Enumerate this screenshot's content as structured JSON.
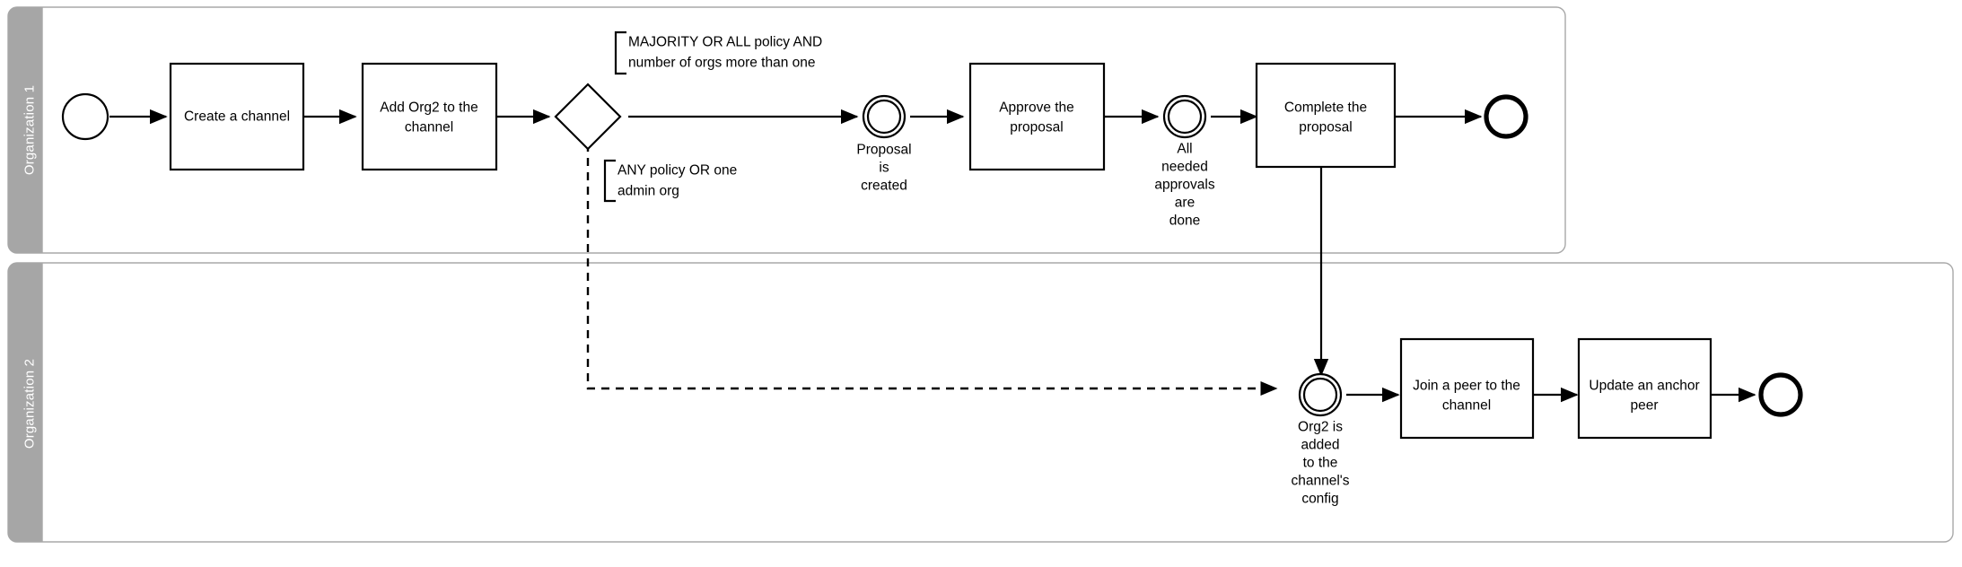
{
  "diagram": {
    "type": "bpmn-collaboration-diagram",
    "background": "#ffffff",
    "lane_band_color": "#a6a6a6",
    "pool_border_color": "#a8a8a8",
    "shape_stroke_color": "#000000"
  },
  "lanes": [
    {
      "id": "lane-organization-1",
      "label": "Organization 1"
    },
    {
      "id": "lane-organization-2",
      "label": "Organization 2"
    }
  ],
  "organization1": {
    "start_event": {
      "label": ""
    },
    "tasks": [
      {
        "id": "task-create-channel",
        "label": "Create a channel"
      },
      {
        "id": "task-add-org2",
        "label": "Add Org2 to the channel"
      },
      {
        "id": "task-approve-proposal",
        "label": "Approve the proposal"
      },
      {
        "id": "task-complete-proposal",
        "label": "Complete the proposal"
      }
    ],
    "task_lines": {
      "create_channel": [
        "Create a channel"
      ],
      "add_org2": [
        "Add Org2 to the",
        "channel"
      ],
      "approve_proposal": [
        "Approve the",
        "proposal"
      ],
      "complete_proposal": [
        "Complete the",
        "proposal"
      ]
    },
    "gateway": {
      "id": "gateway-policy-decision",
      "label": ""
    },
    "events": [
      {
        "id": "event-proposal-created",
        "type": "intermediate",
        "lines": [
          "Proposal",
          "is",
          "created"
        ]
      },
      {
        "id": "event-approvals-done",
        "type": "intermediate",
        "lines": [
          "All",
          "needed",
          "approvals",
          "are",
          "done"
        ]
      }
    ],
    "end_event": {
      "label": ""
    },
    "annotations": [
      {
        "id": "annotation-majority-all-policy",
        "lines": [
          "MAJORITY OR ALL policy AND",
          "number of orgs more than one"
        ]
      },
      {
        "id": "annotation-any-policy",
        "lines": [
          "ANY policy OR one",
          "admin org"
        ]
      }
    ]
  },
  "organization2": {
    "events": [
      {
        "id": "event-org2-added",
        "type": "intermediate",
        "lines": [
          "Org2 is",
          "added",
          "to the",
          "channel's",
          "config"
        ]
      }
    ],
    "tasks": [
      {
        "id": "task-join-peer",
        "label": "Join a peer to the channel"
      },
      {
        "id": "task-update-anchor-peer",
        "label": "Update an anchor peer"
      }
    ],
    "task_lines": {
      "join_peer": [
        "Join a peer to the",
        "channel"
      ],
      "update_anchor_peer": [
        "Update an anchor",
        "peer"
      ]
    },
    "end_event": {
      "label": ""
    }
  }
}
